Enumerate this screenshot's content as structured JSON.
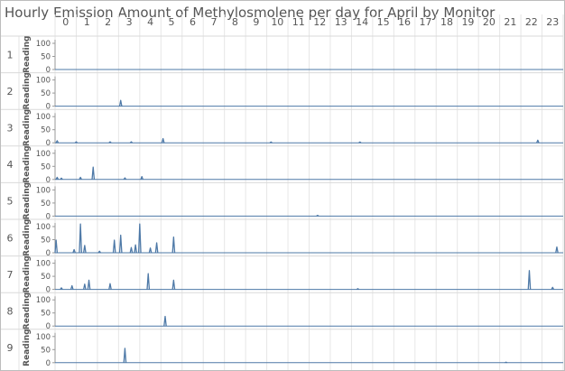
{
  "title": "Hourly Emission Amount of Methylosmolene per day for April by Monitor",
  "colors": {
    "line": "#4e79a7",
    "grid": "#e6e6e6",
    "axis": "#9a9a9a",
    "text": "#555555"
  },
  "chart_data": {
    "type": "line",
    "title": "Hourly Emission Amount of Methylosmolene per day for April by Monitor",
    "columns": [
      "0",
      "1",
      "2",
      "3",
      "4",
      "5",
      "6",
      "7",
      "8",
      "9",
      "10",
      "11",
      "12",
      "13",
      "14",
      "15",
      "16",
      "17",
      "18",
      "19",
      "20",
      "21",
      "22",
      "23"
    ],
    "ylabel": "Reading",
    "ylim": [
      0,
      110
    ],
    "yticks": [
      "0",
      "50",
      "100"
    ],
    "rows": [
      {
        "name": "1",
        "points": []
      },
      {
        "name": "2",
        "points": [
          [
            3.1,
            22
          ]
        ]
      },
      {
        "name": "3",
        "points": [
          [
            0.1,
            8
          ],
          [
            1.0,
            4
          ],
          [
            2.6,
            4
          ],
          [
            3.6,
            4
          ],
          [
            5.1,
            16
          ],
          [
            10.2,
            3
          ],
          [
            14.4,
            3
          ],
          [
            22.8,
            10
          ]
        ]
      },
      {
        "name": "4",
        "points": [
          [
            0.1,
            8
          ],
          [
            0.3,
            5
          ],
          [
            1.2,
            8
          ],
          [
            1.8,
            47
          ],
          [
            3.3,
            6
          ],
          [
            4.1,
            11
          ]
        ]
      },
      {
        "name": "5",
        "points": [
          [
            12.4,
            3
          ]
        ]
      },
      {
        "name": "6",
        "points": [
          [
            0.05,
            48
          ],
          [
            0.9,
            12
          ],
          [
            1.2,
            112
          ],
          [
            1.4,
            28
          ],
          [
            2.1,
            6
          ],
          [
            2.8,
            48
          ],
          [
            3.1,
            67
          ],
          [
            3.6,
            20
          ],
          [
            3.8,
            30
          ],
          [
            4.0,
            112
          ],
          [
            4.5,
            18
          ],
          [
            4.8,
            38
          ],
          [
            5.6,
            60
          ],
          [
            23.7,
            22
          ]
        ]
      },
      {
        "name": "7",
        "points": [
          [
            0.3,
            6
          ],
          [
            0.8,
            14
          ],
          [
            1.4,
            20
          ],
          [
            1.6,
            35
          ],
          [
            2.6,
            22
          ],
          [
            4.4,
            60
          ],
          [
            5.6,
            35
          ],
          [
            14.3,
            3
          ],
          [
            22.4,
            72
          ],
          [
            23.5,
            8
          ]
        ]
      },
      {
        "name": "8",
        "points": [
          [
            5.2,
            37
          ]
        ]
      },
      {
        "name": "9",
        "points": [
          [
            3.3,
            55
          ],
          [
            21.3,
            2
          ]
        ]
      }
    ]
  }
}
